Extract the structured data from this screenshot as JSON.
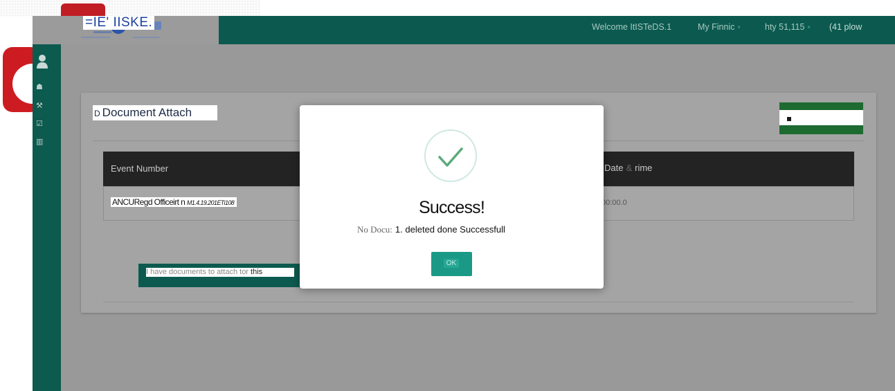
{
  "brand": {
    "logo_text": "=IE'   IISKE."
  },
  "header": {
    "welcome": "Welcome ItISTeDS.1",
    "menu1": "My Finnic",
    "menu2": "hty 51,115",
    "menu3": "(41 plow"
  },
  "sidebar": {
    "icons": [
      "user-icon",
      "dashboard-icon",
      "gavel-icon",
      "checklist-icon",
      "bar-chart-icon"
    ]
  },
  "panel": {
    "title_prefix": "D",
    "title": "Document Attach",
    "table": {
      "headers": [
        "Event Number",
        "Date",
        "&",
        "rime"
      ],
      "row": {
        "event_name": "ANCURegd Officeirt n",
        "event_code": "M1.4.19.201ETi108",
        "datetime": "00:00.0"
      }
    },
    "attach_label": "I have documents to attach tor",
    "attach_label_tail": "this"
  },
  "modal": {
    "title": "Success!",
    "msg_prefix": "No Docu:",
    "msg_text": "1. deleted done Successfull",
    "ok_label": "OK",
    "accent": "#1a9a86"
  },
  "colors": {
    "header": "#0c5a4f",
    "overlay_gray": "#9a9999",
    "table_head": "#232323",
    "brand_red": "#cc1c22"
  }
}
